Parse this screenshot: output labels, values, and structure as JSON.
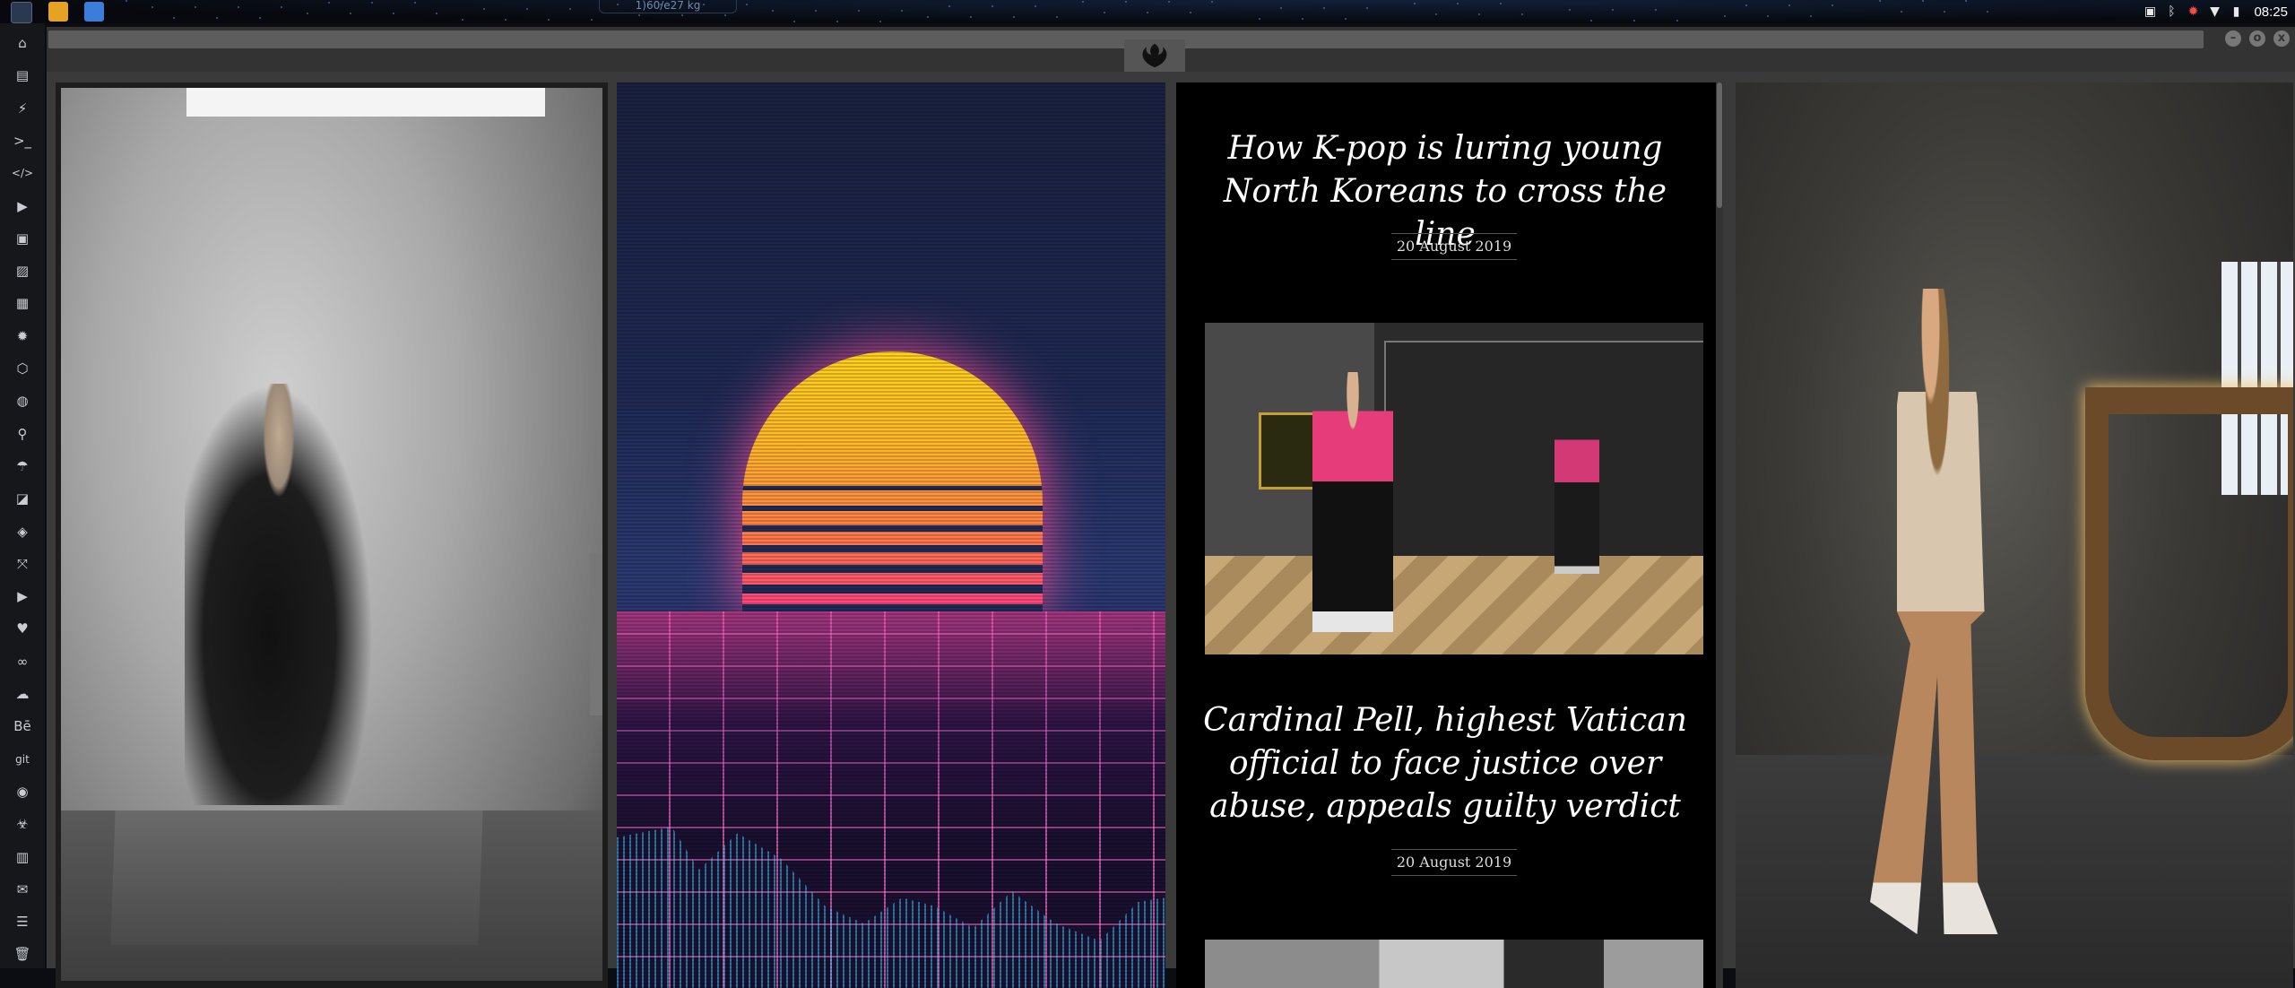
{
  "topbar": {
    "net_meter": "1)60/e27 kg",
    "clock": "08:25",
    "tray_icons": [
      "image-tray-icon",
      "bluetooth-icon",
      "security-icon",
      "wifi-icon",
      "battery-icon"
    ]
  },
  "sidebar": {
    "items": [
      {
        "name": "home-icon",
        "glyph": "⌂"
      },
      {
        "name": "document-icon",
        "glyph": "▤"
      },
      {
        "name": "bolt-icon",
        "glyph": "⚡"
      },
      {
        "name": "terminal-icon",
        "glyph": ">_"
      },
      {
        "name": "code-icon",
        "glyph": "</>"
      },
      {
        "name": "play-icon",
        "glyph": "▶"
      },
      {
        "name": "files-icon",
        "glyph": "▣"
      },
      {
        "name": "image-icon",
        "glyph": "▨"
      },
      {
        "name": "news-icon",
        "glyph": "▦"
      },
      {
        "name": "rebel-icon",
        "glyph": "✹"
      },
      {
        "name": "hex-icon",
        "glyph": "⬡"
      },
      {
        "name": "globe-icon",
        "glyph": "◍"
      },
      {
        "name": "search-icon",
        "glyph": "⚲"
      },
      {
        "name": "umbrella-icon",
        "glyph": "☂"
      },
      {
        "name": "contact-icon",
        "glyph": "◪"
      },
      {
        "name": "tag-icon",
        "glyph": "◈"
      },
      {
        "name": "expand-icon",
        "glyph": "⤧"
      },
      {
        "name": "youtube-icon",
        "glyph": "▶"
      },
      {
        "name": "heart-icon",
        "glyph": "♥"
      },
      {
        "name": "link-icon",
        "glyph": "∞"
      },
      {
        "name": "cloud-icon",
        "glyph": "☁"
      },
      {
        "name": "behance-icon",
        "glyph": "Bē"
      },
      {
        "name": "git-icon",
        "glyph": "git"
      },
      {
        "name": "github-icon",
        "glyph": "◉"
      },
      {
        "name": "biohazard-icon",
        "glyph": "☣"
      },
      {
        "name": "map-icon",
        "glyph": "▥"
      },
      {
        "name": "mail-icon",
        "glyph": "✉"
      },
      {
        "name": "server-icon",
        "glyph": "☰"
      },
      {
        "name": "trash-icon",
        "glyph": "🗑"
      }
    ]
  },
  "window": {
    "controls": [
      "–",
      "o",
      "x"
    ]
  },
  "news": [
    {
      "title": "How K-pop is luring young North Koreans to cross the line",
      "date": "20 August 2019"
    },
    {
      "title": "Cardinal Pell, highest Vatican official to face justice over abuse, appeals guilty verdict",
      "date": "20 August 2019"
    }
  ],
  "colors": {
    "sun_top": "#ffd21f",
    "sun_bottom": "#ff3e86",
    "grid_pink": "#ff6ec8",
    "panel": "#3a3a3a"
  }
}
